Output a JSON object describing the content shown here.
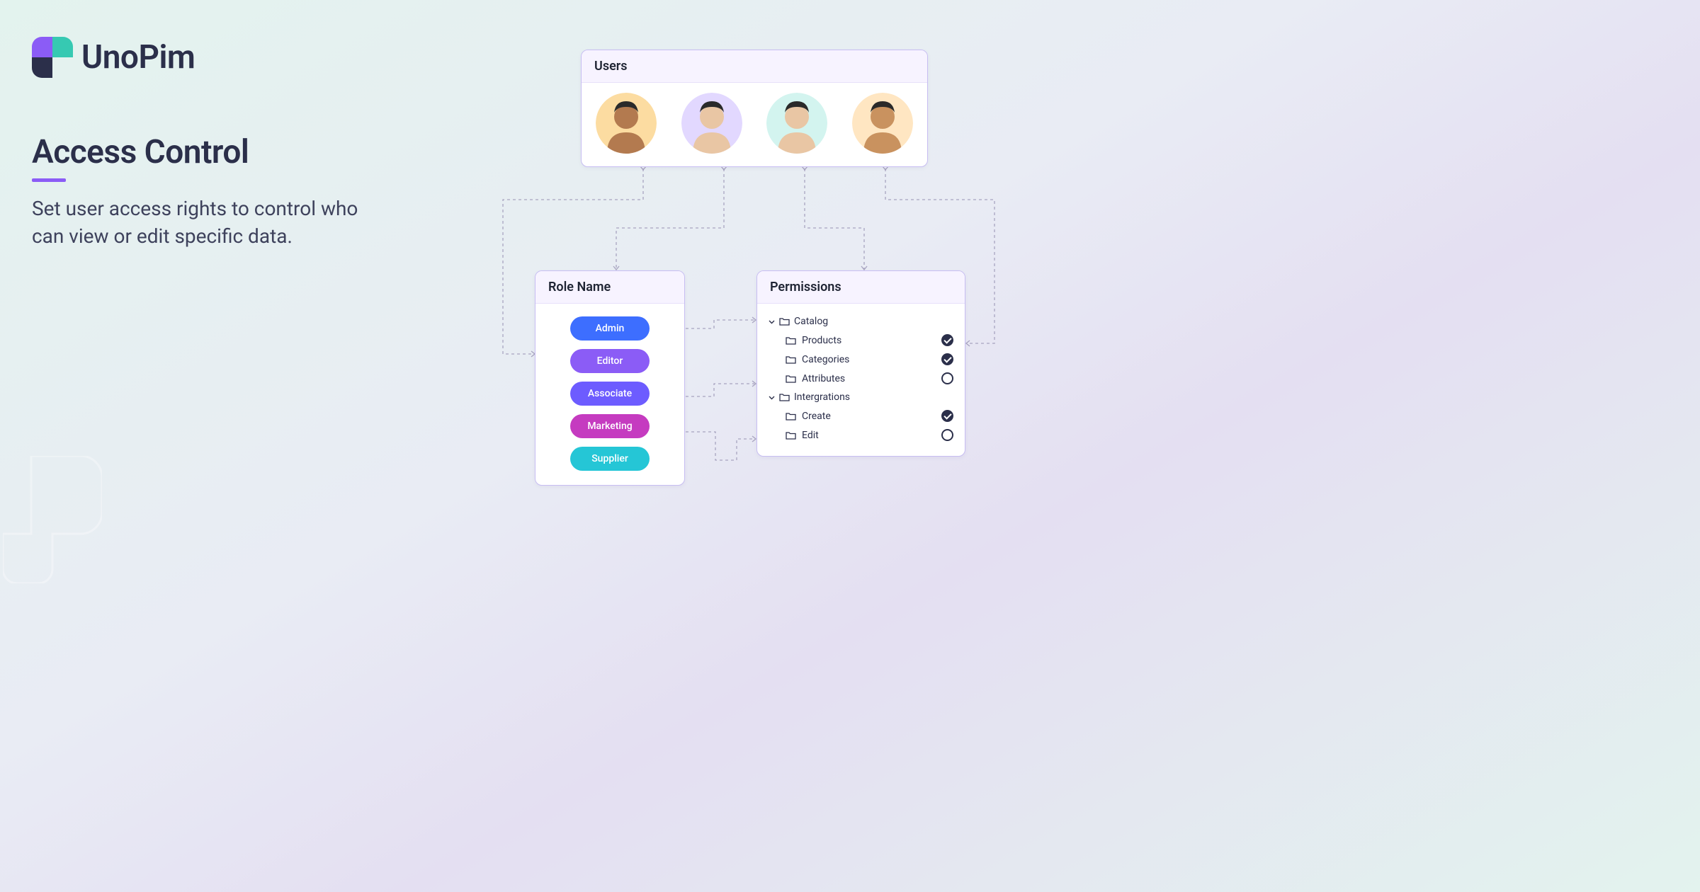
{
  "brand": {
    "name": "UnoPim"
  },
  "headline": {
    "title": "Access Control",
    "subtitle": "Set user access rights to control who can view or edit specific data."
  },
  "users_card": {
    "title": "Users",
    "avatars": [
      {
        "bg": "#fcdca1"
      },
      {
        "bg": "#e2d8ff"
      },
      {
        "bg": "#d3f4ef"
      },
      {
        "bg": "#ffe6c2"
      }
    ]
  },
  "role_card": {
    "title": "Role Name",
    "roles": [
      {
        "label": "Admin",
        "color": "#3d6eff"
      },
      {
        "label": "Editor",
        "color": "#8b5cf6"
      },
      {
        "label": "Associate",
        "color": "#6d5cff"
      },
      {
        "label": "Marketing",
        "color": "#c53bc0"
      },
      {
        "label": "Supplier",
        "color": "#25c6d6"
      }
    ]
  },
  "permissions_card": {
    "title": "Permissions",
    "groups": [
      {
        "label": "Catalog",
        "items": [
          {
            "label": "Products",
            "checked": true
          },
          {
            "label": "Categories",
            "checked": true
          },
          {
            "label": "Attributes",
            "checked": false
          }
        ]
      },
      {
        "label": "Intergrations",
        "items": [
          {
            "label": "Create",
            "checked": true
          },
          {
            "label": "Edit",
            "checked": false
          }
        ]
      }
    ]
  }
}
